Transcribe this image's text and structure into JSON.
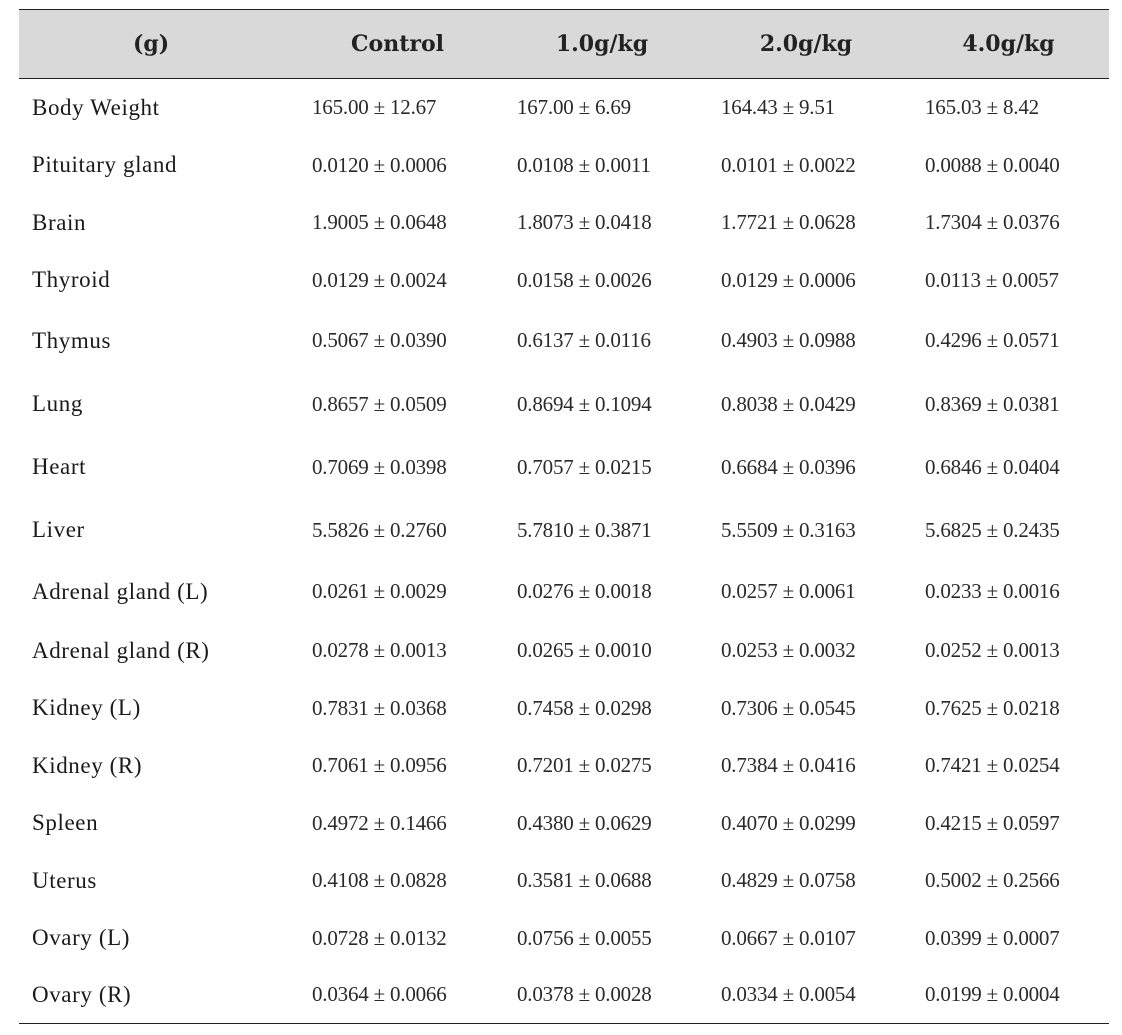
{
  "table": {
    "headers": [
      "(g)",
      "Control",
      "1.0g/kg",
      "2.0g/kg",
      "4.0g/kg"
    ],
    "rows": [
      {
        "label": "Body Weight",
        "values": [
          "165.00 ± 12.67",
          "167.00 ± 6.69",
          "164.43 ± 9.51",
          "165.03 ± 8.42"
        ]
      },
      {
        "label": "Pituitary gland",
        "values": [
          "0.0120 ± 0.0006",
          "0.0108 ± 0.0011",
          "0.0101 ± 0.0022",
          "0.0088 ± 0.0040"
        ]
      },
      {
        "label": "Brain",
        "values": [
          "1.9005 ± 0.0648",
          "1.8073 ± 0.0418",
          "1.7721 ± 0.0628",
          "1.7304 ± 0.0376"
        ]
      },
      {
        "label": "Thyroid",
        "values": [
          "0.0129 ± 0.0024",
          "0.0158 ± 0.0026",
          "0.0129 ± 0.0006",
          "0.0113 ± 0.0057"
        ]
      },
      {
        "label": "Thymus",
        "values": [
          "0.5067 ± 0.0390",
          "0.6137 ± 0.0116",
          "0.4903 ± 0.0988",
          "0.4296 ± 0.0571"
        ]
      },
      {
        "label": "Lung",
        "values": [
          "0.8657 ± 0.0509",
          "0.8694 ± 0.1094",
          "0.8038 ± 0.0429",
          "0.8369 ± 0.0381"
        ]
      },
      {
        "label": "Heart",
        "values": [
          "0.7069 ± 0.0398",
          "0.7057 ± 0.0215",
          "0.6684 ± 0.0396",
          "0.6846 ± 0.0404"
        ]
      },
      {
        "label": "Liver",
        "values": [
          "5.5826 ± 0.2760",
          "5.7810 ± 0.3871",
          "5.5509 ± 0.3163",
          "5.6825 ± 0.2435"
        ]
      },
      {
        "label": "Adrenal gland (L)",
        "values": [
          "0.0261 ± 0.0029",
          "0.0276 ± 0.0018",
          "0.0257 ± 0.0061",
          "0.0233 ± 0.0016"
        ]
      },
      {
        "label": "Adrenal gland (R)",
        "values": [
          "0.0278 ± 0.0013",
          "0.0265 ± 0.0010",
          "0.0253 ± 0.0032",
          "0.0252 ± 0.0013"
        ]
      },
      {
        "label": "Kidney (L)",
        "values": [
          "0.7831 ± 0.0368",
          "0.7458 ± 0.0298",
          "0.7306 ± 0.0545",
          "0.7625 ± 0.0218"
        ]
      },
      {
        "label": "Kidney (R)",
        "values": [
          "0.7061 ± 0.0956",
          "0.7201 ± 0.0275",
          "0.7384 ± 0.0416",
          "0.7421 ± 0.0254"
        ]
      },
      {
        "label": "Spleen",
        "values": [
          "0.4972 ± 0.1466",
          "0.4380 ± 0.0629",
          "0.4070 ± 0.0299",
          "0.4215 ± 0.0597"
        ]
      },
      {
        "label": "Uterus",
        "values": [
          "0.4108 ± 0.0828",
          "0.3581 ± 0.0688",
          "0.4829 ± 0.0758",
          "0.5002 ± 0.2566"
        ]
      },
      {
        "label": "Ovary (L)",
        "values": [
          "0.0728 ± 0.0132",
          "0.0756 ± 0.0055",
          "0.0667 ± 0.0107",
          "0.0399 ± 0.0007"
        ]
      },
      {
        "label": "Ovary (R)",
        "values": [
          "0.0364 ± 0.0066",
          "0.0378 ± 0.0028",
          "0.0334 ± 0.0054",
          "0.0199 ± 0.0004"
        ]
      }
    ]
  },
  "colors": {
    "header_background": "#d9d9d9",
    "rule": "#222222",
    "text": "#1a1a1a"
  }
}
